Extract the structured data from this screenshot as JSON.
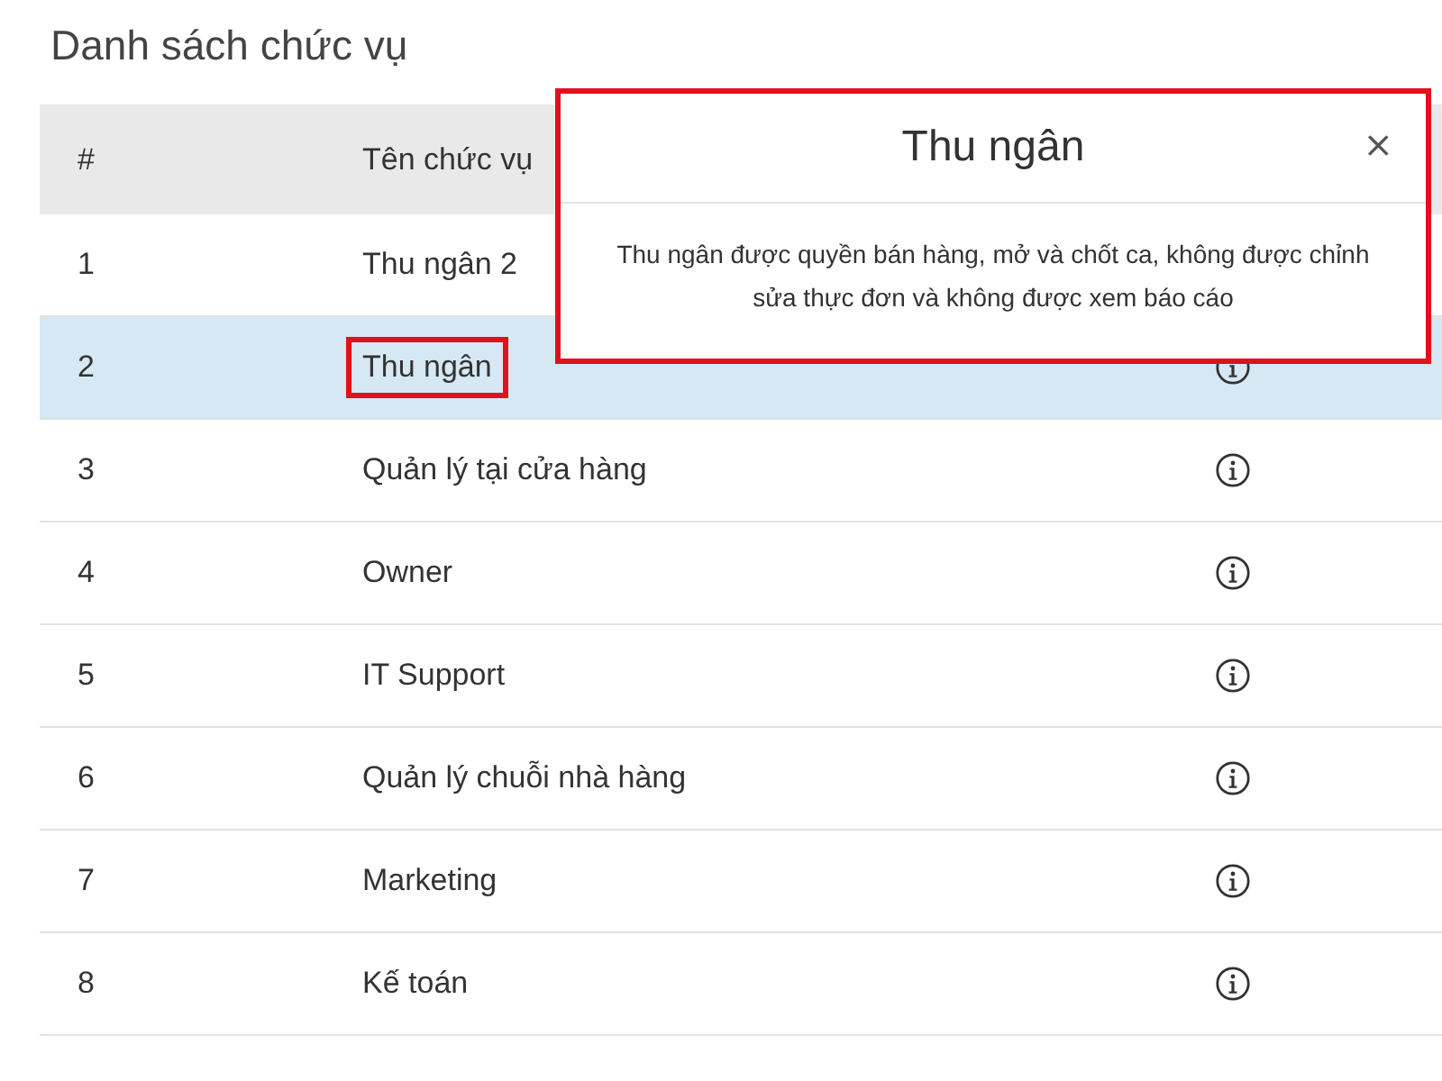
{
  "title": "Danh sách chức vụ",
  "table": {
    "columns": [
      "#",
      "Tên chức vụ"
    ],
    "rows": [
      {
        "index": "1",
        "name": "Thu ngân 2",
        "selected": false,
        "highlighted": false
      },
      {
        "index": "2",
        "name": "Thu ngân",
        "selected": true,
        "highlighted": true,
        "info": true
      },
      {
        "index": "3",
        "name": "Quản lý tại cửa hàng",
        "selected": false,
        "highlighted": false,
        "info": true
      },
      {
        "index": "4",
        "name": "Owner",
        "selected": false,
        "highlighted": false,
        "info": true
      },
      {
        "index": "5",
        "name": "IT Support",
        "selected": false,
        "highlighted": false,
        "info": true
      },
      {
        "index": "6",
        "name": "Quản lý chuỗi nhà hàng",
        "selected": false,
        "highlighted": false,
        "info": true
      },
      {
        "index": "7",
        "name": "Marketing",
        "selected": false,
        "highlighted": false,
        "info": true
      },
      {
        "index": "8",
        "name": "Kế toán",
        "selected": false,
        "highlighted": false,
        "info": true
      }
    ]
  },
  "popover": {
    "title": "Thu ngân",
    "close": "×",
    "body": "Thu ngân được quyền bán hàng, mở và chốt ca, không được chỉnh sửa thực đơn và không được xem báo cáo"
  }
}
